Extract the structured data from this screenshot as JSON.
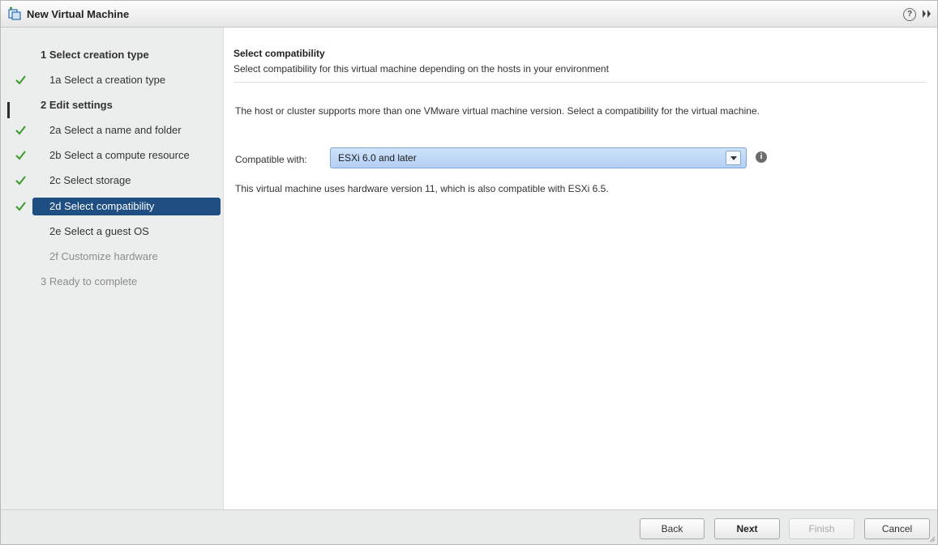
{
  "window": {
    "title": "New Virtual Machine",
    "help_symbol": "?"
  },
  "sidebar": {
    "steps": [
      {
        "label": "1  Select creation type",
        "completed": false,
        "type": "main"
      },
      {
        "label": "1a  Select a creation type",
        "completed": true,
        "type": "sub"
      },
      {
        "label": "2  Edit settings",
        "completed": false,
        "type": "main"
      },
      {
        "label": "2a  Select a name and folder",
        "completed": true,
        "type": "sub"
      },
      {
        "label": "2b  Select a compute resource",
        "completed": true,
        "type": "sub"
      },
      {
        "label": "2c  Select storage",
        "completed": true,
        "type": "sub"
      },
      {
        "label": "2d  Select compatibility",
        "completed": true,
        "type": "sub",
        "selected": true
      },
      {
        "label": "2e  Select a guest OS",
        "completed": false,
        "type": "sub"
      },
      {
        "label": "2f  Customize hardware",
        "completed": false,
        "type": "sub",
        "disabled": true
      },
      {
        "label": "3  Ready to complete",
        "completed": false,
        "type": "main",
        "disabled": true
      }
    ]
  },
  "main": {
    "heading": "Select compatibility",
    "subheading": "Select compatibility for this virtual machine depending on the hosts in your environment",
    "info": "The host or cluster supports more than one VMware virtual machine version. Select a compatibility for the virtual machine.",
    "compat_label": "Compatible with:",
    "compat_value": "ESXi 6.0 and later",
    "hw_note": "This virtual machine uses hardware version 11, which is also compatible with ESXi 6.5."
  },
  "footer": {
    "back": "Back",
    "next": "Next",
    "finish": "Finish",
    "cancel": "Cancel"
  },
  "colors": {
    "selected_step": "#1f4f82",
    "check": "#3a9a2a",
    "select_bg": "#c1d9f6"
  }
}
